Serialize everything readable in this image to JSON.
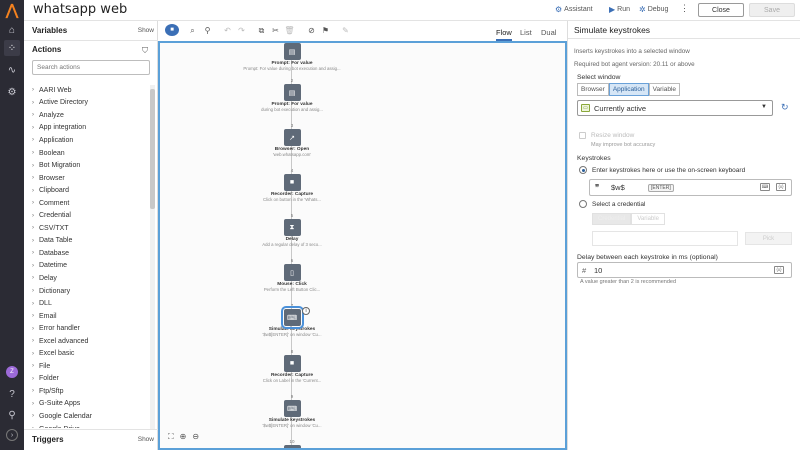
{
  "header": {
    "title": "whatsapp web",
    "assistant_label": "Assistant",
    "run_label": "Run",
    "debug_label": "Debug",
    "close_label": "Close",
    "save_label": "Save"
  },
  "left_panel": {
    "variables_title": "Variables",
    "variables_show": "Show",
    "actions_title": "Actions",
    "search_placeholder": "Search actions",
    "actions": [
      "AARI Web",
      "Active Directory",
      "Analyze",
      "App integration",
      "Application",
      "Boolean",
      "Bot Migration",
      "Browser",
      "Clipboard",
      "Comment",
      "Credential",
      "CSV/TXT",
      "Data Table",
      "Database",
      "Datetime",
      "Delay",
      "Dictionary",
      "DLL",
      "Email",
      "Error handler",
      "Excel advanced",
      "Excel basic",
      "File",
      "Folder",
      "Ftp/Sftp",
      "G-Suite Apps",
      "Google Calendar",
      "Google Drive"
    ],
    "triggers_title": "Triggers",
    "triggers_show": "Show"
  },
  "toolbar": {
    "tabs": [
      "Flow",
      "List",
      "Dual"
    ],
    "active_tab": "Flow"
  },
  "flow": {
    "nodes": [
      {
        "num": "",
        "name": "Prompt: For value",
        "desc": "Prompt: For value during bot execution and assig...",
        "icon": "prompt-icon"
      },
      {
        "num": "2",
        "name": "Prompt: For value",
        "desc": "during bot execution and assig...",
        "icon": "prompt-icon"
      },
      {
        "num": "3",
        "name": "Browser: Open",
        "desc": "'web.whatsapp.com'",
        "icon": "browser-open-icon"
      },
      {
        "num": "4",
        "name": "Recorder: Capture",
        "desc": "Click on button in the 'Whats...",
        "icon": "recorder-icon"
      },
      {
        "num": "5",
        "name": "Delay",
        "desc": "Add a regular delay of 3 seco...",
        "icon": "hourglass-icon"
      },
      {
        "num": "6",
        "name": "Mouse: Click",
        "desc": "Perform the Left Button Clic...",
        "icon": "mouse-icon"
      },
      {
        "num": "7",
        "name": "Simulate keystrokes",
        "desc": "'$w$[ENTER]' on window 'Cu...",
        "icon": "keyboard-icon"
      },
      {
        "num": "8",
        "name": "Recorder: Capture",
        "desc": "Click on Label in the 'Current...",
        "icon": "recorder-icon"
      },
      {
        "num": "9",
        "name": "Simulate keystrokes",
        "desc": "'$w$[ENTER]' on window 'Cu...",
        "icon": "keyboard-icon"
      },
      {
        "num": "10",
        "name": "",
        "desc": "",
        "icon": "hourglass-icon"
      }
    ]
  },
  "right_panel": {
    "title": "Simulate keystrokes",
    "description": "Inserts keystrokes into a selected window",
    "version_note": "Required bot agent version: 20.11 or above",
    "select_window_label": "Select window",
    "window_tabs": [
      "Browser",
      "Application",
      "Variable"
    ],
    "active_window_tab": "Application",
    "window_value": "Currently active",
    "resize_label": "Resize window",
    "resize_note": "May improve bot accuracy",
    "keystrokes_label": "Keystrokes",
    "option_keystrokes": "Enter keystrokes here or use the on-screen keyboard",
    "keystrokes_value": "$w$",
    "keystrokes_tag": "[ENTER]",
    "option_credential": "Select a credential",
    "credential_tabs": [
      "Credential",
      "Variable"
    ],
    "credential_pick": "Pick",
    "delay_label": "Delay between each keystroke in ms (optional)",
    "delay_value": "10",
    "delay_note": "A value greater than 2 is recommended"
  },
  "colors": {
    "accent": "#3b6fb6",
    "rail_bg": "#2b2b34",
    "logo": "#f5821f",
    "canvas_border": "#5ba0d8",
    "node_bg": "#5f6a78"
  }
}
